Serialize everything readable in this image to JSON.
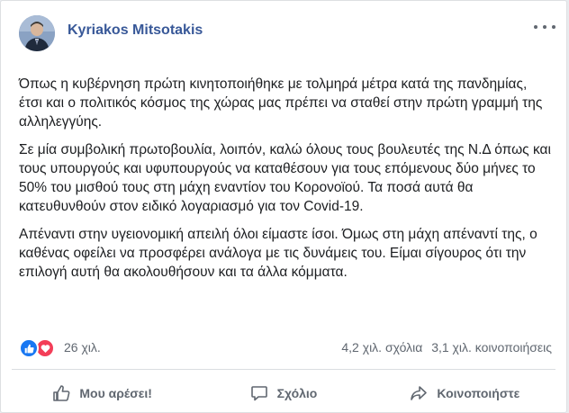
{
  "post": {
    "author": "Kyriakos Mitsotakis",
    "paragraphs": [
      "Όπως η κυβέρνηση πρώτη κινητοποιήθηκε με τολμηρά μέτρα κατά της πανδημίας, έτσι και ο πολιτικός κόσμος της χώρας μας πρέπει να σταθεί στην πρώτη γραμμή της αλληλεγγύης.",
      "Σε μία συμβολική πρωτοβουλία, λοιπόν, καλώ όλους τους βουλευτές της Ν.Δ όπως και τους υπουργούς και υφυπουργούς να καταθέσουν για τους επόμενους δύο μήνες το 50% του μισθού τους στη μάχη εναντίον του Κορονοϊού. Τα ποσά αυτά θα κατευθυνθούν στον ειδικό λογαριασμό για τον Covid-19.",
      "Απέναντι στην υγειονομική απειλή όλοι είμαστε ίσοι. Όμως στη μάχη απέναντί της, ο καθένας οφείλει να προσφέρει ανάλογα με τις δυνάμεις του. Είμαι σίγουρος ότι την επιλογή αυτή θα ακολουθήσουν και τα άλλα κόμματα."
    ]
  },
  "stats": {
    "reactions": "26 χιλ.",
    "comments": "4,2 χιλ. σχόλια",
    "shares": "3,1 χιλ. κοινοποιήσεις"
  },
  "actions": {
    "like": "Μου αρέσει!",
    "comment": "Σχόλιο",
    "share": "Κοινοποιήστε"
  },
  "icons": {
    "avatar": "avatar-photo",
    "more": "more-horizontal-icon",
    "like_reaction": "like-reaction-icon",
    "love_reaction": "love-reaction-icon",
    "like": "thumbs-up-icon",
    "comment": "comment-bubble-icon",
    "share": "share-arrow-icon"
  },
  "colors": {
    "author": "#385898",
    "text": "#1c1e21",
    "meta": "#606770",
    "like": "#1877f2",
    "love": "#f33e58"
  }
}
